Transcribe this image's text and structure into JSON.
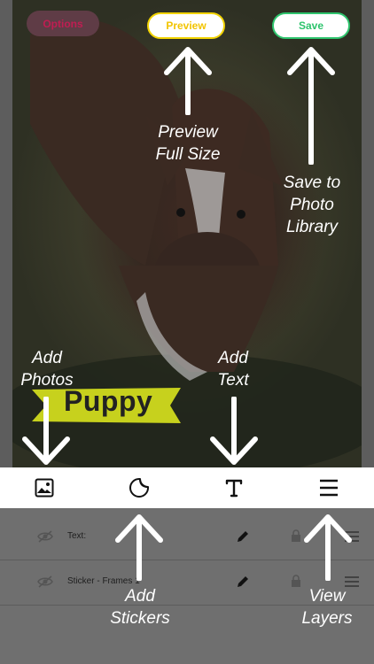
{
  "header": {
    "options_label": "Options",
    "preview_label": "Preview",
    "save_label": "Save"
  },
  "sticker": {
    "text": "Puppy"
  },
  "callouts": {
    "preview": [
      "Preview",
      "Full Size"
    ],
    "save": [
      "Save to",
      "Photo",
      "Library"
    ],
    "add_photos": [
      "Add",
      "Photos"
    ],
    "add_text": [
      "Add",
      "Text"
    ],
    "add_stickers": [
      "Add",
      "Stickers"
    ],
    "view_layers": [
      "View",
      "Layers"
    ]
  },
  "toolbar": {
    "icons": [
      "image-icon",
      "sticker-icon",
      "text-icon",
      "layers-menu-icon"
    ]
  },
  "layers": {
    "rows": [
      {
        "label": "Text:"
      },
      {
        "label": "Sticker - Frames 1"
      }
    ]
  },
  "colors": {
    "options_text": "#c01d52",
    "preview_accent": "#f2c400",
    "save_accent": "#2ec46d",
    "sticker_ribbon": "#c7d11d"
  }
}
